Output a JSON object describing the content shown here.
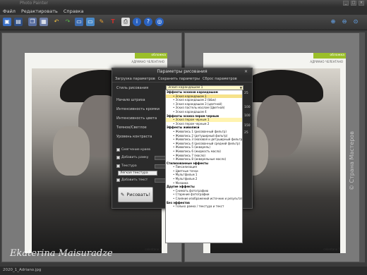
{
  "window": {
    "title": "Photo Painter"
  },
  "menu": [
    "Файл",
    "Редактировать",
    "Справка"
  ],
  "status": "2020_1_Adriano.jpg",
  "watermark": {
    "signature": "Ekaterina Maisuradze",
    "site": "© Страна Мастеров"
  },
  "magazine": {
    "tag": "обложка",
    "subtitle": "АДРИАНО ЧЕЛЕНТАНО",
    "page": "celentano 5"
  },
  "dialog": {
    "title": "Параметры рисования",
    "tabs": [
      "Загрузка параметров",
      "Сохранить параметры",
      "Сброс параметров"
    ],
    "style_label": "Стиль рисования",
    "selected_style": "Эскиз карандашом 1",
    "fields": [
      "Начало штриха",
      "Интенсивность кромки",
      "Интенсивность цвета",
      "Темное/Светлое",
      "Уровень контраста"
    ],
    "checks": [
      "Смягчение краев",
      "Добавить рамку",
      "Текстура",
      "Добавить текст"
    ],
    "texture_value": "Легкая текстура",
    "draw_button": "Рисовать!"
  },
  "slider_values": [
    "25",
    "100",
    "100",
    "150",
    "25"
  ],
  "dropdown": [
    {
      "text": "Эффекты эскизов карандашом",
      "group": true
    },
    {
      "text": "Эскиз карандашом 1",
      "selected": true
    },
    {
      "text": "Эскиз карандашом 2 (b&w)"
    },
    {
      "text": "Эскиз карандашом 3 (цветной)"
    },
    {
      "text": "Эскиз пастель маслом (Цветной)"
    },
    {
      "text": "Эскиз карандашом 4"
    },
    {
      "text": "Эффекты эскиза пером черным",
      "group": true
    },
    {
      "text": "Эскиз пером черным 1",
      "highlight": true
    },
    {
      "text": "Эскиз пером черным 2"
    },
    {
      "text": "Эффекты живописи",
      "group": true
    },
    {
      "text": "Живопись 1 (рисованный фильтр)"
    },
    {
      "text": "Живопись 2 (детуширный фильтр)"
    },
    {
      "text": "Живопись 3 (мазовая и детуширный фильтр)"
    },
    {
      "text": "Живопись 4 (рисованный средний фильтр)"
    },
    {
      "text": "Живопись 5 (акварель)"
    },
    {
      "text": "Живопись 6 (жидкость масла)"
    },
    {
      "text": "Живопись 7 (масло)"
    },
    {
      "text": "Живопись 8 (акварельные масло)"
    },
    {
      "text": "Стилизованные эффекты",
      "group": true
    },
    {
      "text": "Пиксилизация"
    },
    {
      "text": "Цветные точки"
    },
    {
      "text": "Мультфильм 1"
    },
    {
      "text": "Мультфильм 2"
    },
    {
      "text": "Мозаика"
    },
    {
      "text": "Другие эффекты",
      "group": true
    },
    {
      "text": "Снимать фотографию"
    },
    {
      "text": "Старение фотографии"
    },
    {
      "text": "Слияние изображений источник и результат"
    },
    {
      "text": "Без эффектов",
      "group": true
    },
    {
      "text": "Только рамка / текстура и текст"
    }
  ],
  "toolbar_icons": [
    "new-icon",
    "save-icon",
    "copy-icon",
    "paste-icon",
    "undo-icon",
    "redo-icon",
    "image-icon",
    "landscape-icon",
    "settings-icon",
    "text-icon",
    "print-icon",
    "info-icon",
    "help-icon",
    "globe-icon",
    "zoom-in-icon",
    "zoom-out-icon",
    "zoom-fit-icon"
  ]
}
